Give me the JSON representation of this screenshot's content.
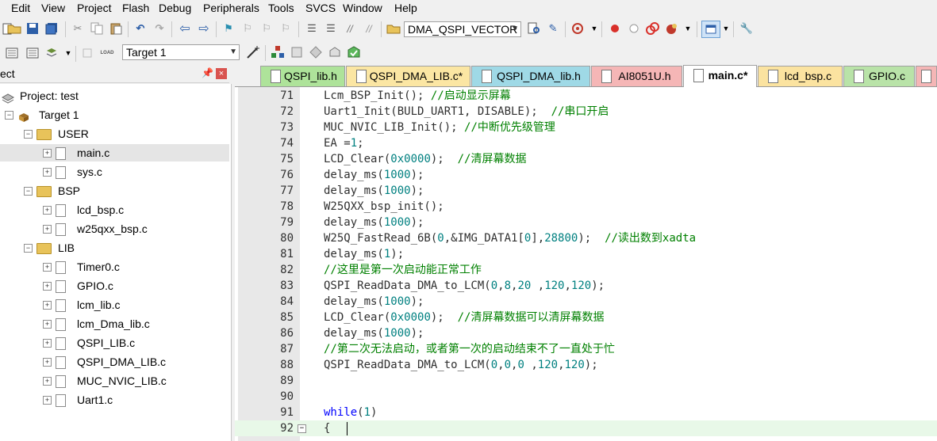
{
  "menu": [
    "Edit",
    "View",
    "Project",
    "Flash",
    "Debug",
    "Peripherals",
    "Tools",
    "SVCS",
    "Window",
    "Help"
  ],
  "toolbar1": {
    "target_combo": "DMA_QSPI_VECTOR",
    "icons": [
      "new-file-icon",
      "open-folder-icon",
      "save-icon",
      "save-all-icon",
      "cut-icon",
      "copy-icon",
      "paste-icon",
      "undo-icon",
      "redo-icon",
      "navigate-back-icon",
      "navigate-forward-icon",
      "bookmark-icon",
      "bookmark-prev-icon",
      "bookmark-next-icon",
      "bookmark-clear-icon",
      "indent-icon",
      "unindent-icon",
      "comment-icon",
      "uncomment-icon",
      "find-in-files-icon",
      "find-icon",
      "debug-start-icon",
      "breakpoint-icon",
      "breakpoint-disable-icon",
      "breakpoint-kill-icon",
      "window-layout-icon",
      "settings-wrench-icon"
    ]
  },
  "toolbar2": {
    "target_combo": "Target 1",
    "load_label": "LOAD"
  },
  "project_panel": {
    "title": "ect",
    "project_label": "Project: test",
    "target_label": "Target 1",
    "groups": [
      {
        "name": "USER",
        "files": [
          "main.c",
          "sys.c"
        ]
      },
      {
        "name": "BSP",
        "files": [
          "lcd_bsp.c",
          "w25qxx_bsp.c"
        ]
      },
      {
        "name": "LIB",
        "files": [
          "Timer0.c",
          "GPIO.c",
          "lcm_lib.c",
          "lcm_Dma_lib.c",
          "QSPI_LIB.c",
          "QSPI_DMA_LIB.c",
          "MUC_NVIC_LIB.c",
          "Uart1.c"
        ]
      }
    ]
  },
  "tabs": [
    {
      "label": "QSPI_lib.h",
      "color": "#aee39a",
      "active": false
    },
    {
      "label": "QSPI_DMA_LIB.c*",
      "color": "#fbe6a3",
      "active": false
    },
    {
      "label": "QSPI_DMA_lib.h",
      "color": "#9fd9e6",
      "active": false
    },
    {
      "label": "AI8051U.h",
      "color": "#f5b6b6",
      "active": false
    },
    {
      "label": "main.c*",
      "color": "#ffffff",
      "active": true
    },
    {
      "label": "lcd_bsp.c",
      "color": "#fbe3a0",
      "active": false
    },
    {
      "label": "GPIO.c",
      "color": "#b9e3a8",
      "active": false
    },
    {
      "label": "",
      "color": "#f5b6b6",
      "active": false
    }
  ],
  "code": [
    {
      "n": "71",
      "t": "Lcm_BSP_Init(); //启动显示屏幕"
    },
    {
      "n": "72",
      "t": "Uart1_Init(BULD_UART1, DISABLE);  //串口开启"
    },
    {
      "n": "73",
      "t": "MUC_NVIC_LIB_Init(); //中断优先级管理"
    },
    {
      "n": "74",
      "t": "EA =1;"
    },
    {
      "n": "75",
      "t": "LCD_Clear(0x0000);  //清屏幕数据"
    },
    {
      "n": "76",
      "t": "delay_ms(1000);"
    },
    {
      "n": "77",
      "t": "delay_ms(1000);"
    },
    {
      "n": "78",
      "t": "W25QXX_bsp_init();"
    },
    {
      "n": "79",
      "t": "delay_ms(1000);"
    },
    {
      "n": "80",
      "t": "W25Q_FastRead_6B(0,&IMG_DATA1[0],28800);  //读出数到xadta"
    },
    {
      "n": "81",
      "t": "delay_ms(1);"
    },
    {
      "n": "82",
      "t": "//这里是第一次启动能正常工作"
    },
    {
      "n": "83",
      "t": "QSPI_ReadData_DMA_to_LCM(0,8,20 ,120,120);"
    },
    {
      "n": "84",
      "t": "delay_ms(1000);"
    },
    {
      "n": "85",
      "t": "LCD_Clear(0x0000);  //清屏幕数据可以清屏幕数据"
    },
    {
      "n": "86",
      "t": "delay_ms(1000);"
    },
    {
      "n": "87",
      "t": "//第二次无法启动，或者第一次的启动结束不了一直处于忙"
    },
    {
      "n": "88",
      "t": "QSPI_ReadData_DMA_to_LCM(0,0,0 ,120,120);"
    },
    {
      "n": "89",
      "t": ""
    },
    {
      "n": "90",
      "t": "  "
    },
    {
      "n": "91",
      "t": "while(1)"
    },
    {
      "n": "92",
      "t": "{ "
    }
  ],
  "colors": {
    "comment": "#008000",
    "number": "#008080",
    "keyword": "#0000ff",
    "current_line": "#e8f8e8"
  }
}
